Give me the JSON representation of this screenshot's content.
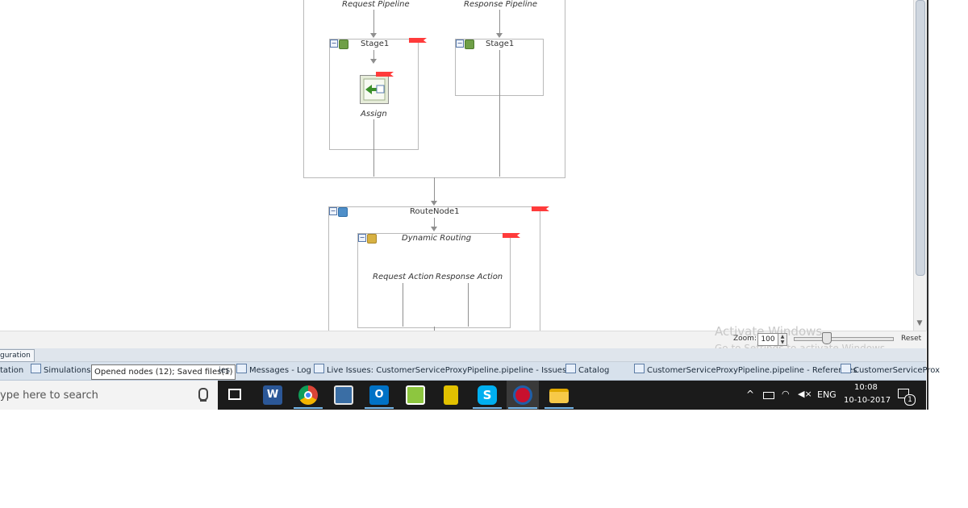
{
  "diagram": {
    "request_pipeline": "Request Pipeline",
    "response_pipeline": "Response Pipeline",
    "stage1_req": "Stage1",
    "stage1_resp": "Stage1",
    "assign": "Assign",
    "route_node": "RouteNode1",
    "dynamic_routing": "Dynamic Routing",
    "request_action": "Request Action",
    "response_action": "Response Action"
  },
  "zoom": {
    "label": "Zoom:",
    "value": "100",
    "reset": "Reset"
  },
  "activate_windows": {
    "title": "Activate Windows",
    "subtitle": "Go to Settings to activate Windows."
  },
  "bottom_tabs_row1": {
    "configuration": "guration"
  },
  "bottom_tabs_row2": {
    "tabs": [
      {
        "label": "tation"
      },
      {
        "label": "Simulations"
      },
      {
        "label": "ies"
      },
      {
        "label": "Messages - Log"
      },
      {
        "label": "Live Issues: CustomerServiceProxyPipeline.pipeline - Issues"
      },
      {
        "label": "Catalog"
      },
      {
        "label": "CustomerServiceProxyPipeline.pipeline - References"
      },
      {
        "label": "CustomerServiceProx"
      }
    ],
    "tooltip": "Opened nodes (12); Saved files(1)"
  },
  "taskbar": {
    "search_placeholder": "ype here to search",
    "language": "ENG",
    "time": "10:08",
    "date": "10-10-2017",
    "notification_count": "1"
  },
  "colors": {
    "flag": "#ff3b3b",
    "taskbar_bg": "#1b1b1b",
    "accent_underline": "#76b9ed"
  }
}
